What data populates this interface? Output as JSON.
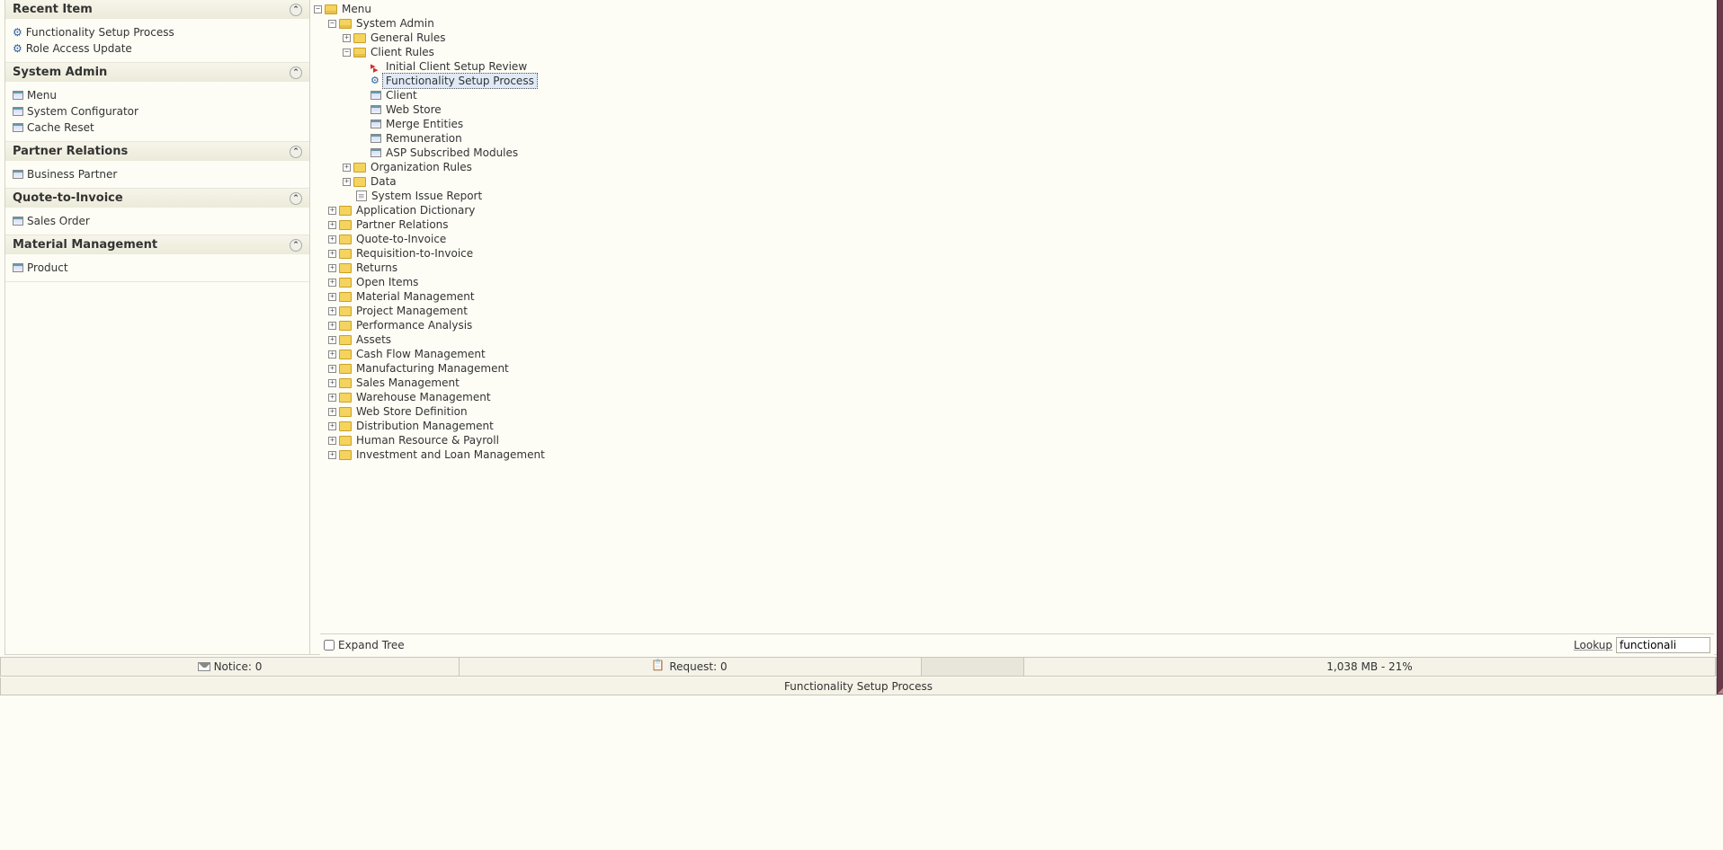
{
  "sidebar": {
    "sections": [
      {
        "title": "Recent Item",
        "items": [
          {
            "icon": "gear",
            "label": "Functionality Setup Process"
          },
          {
            "icon": "gear",
            "label": "Role Access Update"
          }
        ]
      },
      {
        "title": "System Admin",
        "items": [
          {
            "icon": "window",
            "label": "Menu"
          },
          {
            "icon": "window",
            "label": "System Configurator"
          },
          {
            "icon": "window",
            "label": "Cache Reset"
          }
        ]
      },
      {
        "title": "Partner Relations",
        "items": [
          {
            "icon": "window",
            "label": "Business Partner"
          }
        ]
      },
      {
        "title": "Quote-to-Invoice",
        "items": [
          {
            "icon": "window",
            "label": "Sales Order"
          }
        ]
      },
      {
        "title": "Material Management",
        "items": [
          {
            "icon": "window",
            "label": "Product"
          }
        ]
      }
    ]
  },
  "tree": {
    "root": {
      "label": "Menu",
      "exp": "minus",
      "icon": "folder-open"
    },
    "system_admin": {
      "label": "System Admin",
      "exp": "minus",
      "icon": "folder-open"
    },
    "general_rules": {
      "label": "General Rules",
      "exp": "plus",
      "icon": "folder-closed"
    },
    "client_rules": {
      "label": "Client Rules",
      "exp": "minus",
      "icon": "folder-open"
    },
    "cr_items": [
      {
        "label": "Initial Client Setup Review",
        "icon": "process-red"
      },
      {
        "label": "Functionality Setup Process",
        "icon": "gear",
        "selected": true
      },
      {
        "label": "Client",
        "icon": "window"
      },
      {
        "label": "Web Store",
        "icon": "window"
      },
      {
        "label": "Merge Entities",
        "icon": "window"
      },
      {
        "label": "Remuneration",
        "icon": "window"
      },
      {
        "label": "ASP Subscribed Modules",
        "icon": "window"
      }
    ],
    "org_rules": {
      "label": "Organization Rules",
      "exp": "plus",
      "icon": "folder-closed"
    },
    "data": {
      "label": "Data",
      "exp": "plus",
      "icon": "folder-closed"
    },
    "sys_issue": {
      "label": "System Issue Report",
      "icon": "report"
    },
    "top_folders": [
      "Application Dictionary",
      "Partner Relations",
      "Quote-to-Invoice",
      "Requisition-to-Invoice",
      "Returns",
      "Open Items",
      "Material Management",
      "Project Management",
      "Performance Analysis",
      "Assets",
      "Cash Flow Management",
      "Manufacturing Management",
      "Sales Management",
      "Warehouse Management",
      "Web Store Definition",
      "Distribution Management",
      "Human Resource & Payroll",
      "Investment and Loan Management"
    ]
  },
  "bottom": {
    "expand_tree_label": "Expand Tree",
    "lookup_label": "Lookup",
    "lookup_value": "functionali"
  },
  "status": {
    "notice": "Notice: 0",
    "request": "Request: 0",
    "memory": "1,038 MB - 21%"
  },
  "footer": {
    "text": "Functionality Setup Process"
  }
}
